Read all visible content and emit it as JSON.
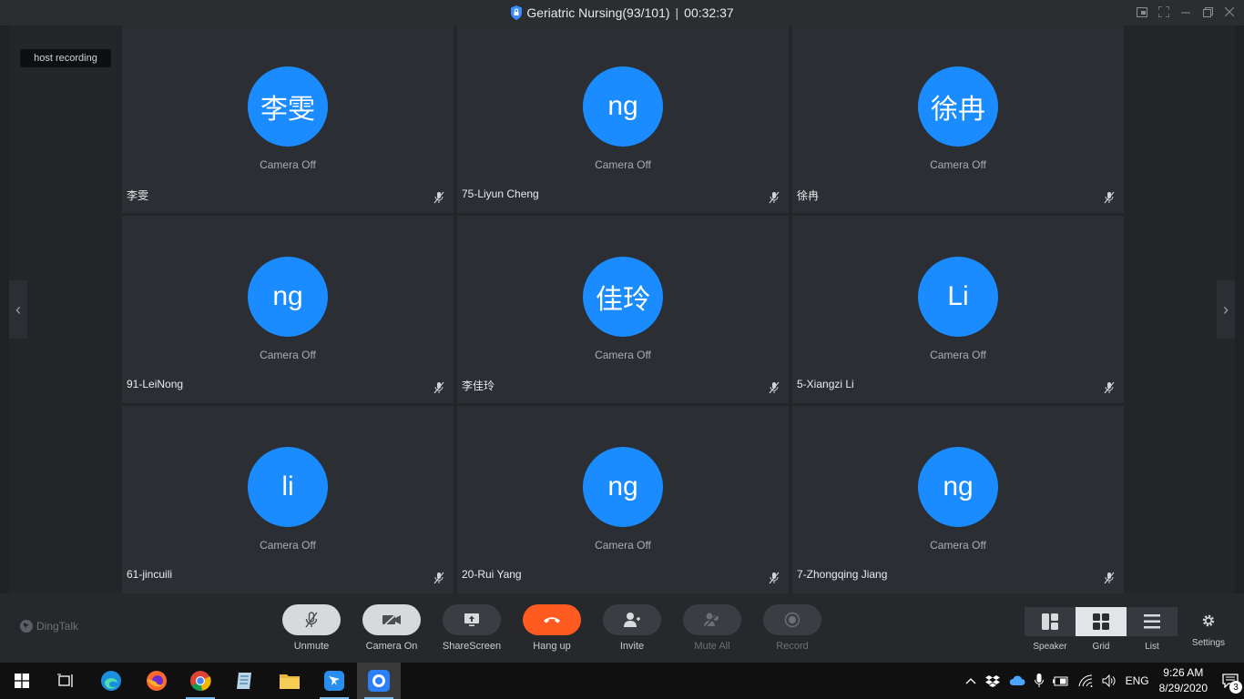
{
  "window": {
    "title": "Geriatric Nursing(93/101)",
    "separator": "|",
    "timer": "00:32:37"
  },
  "stage": {
    "recording_badge": "host recording",
    "nav_prev": "‹",
    "nav_next": "›"
  },
  "participants": [
    {
      "avatar_text": "李雯",
      "camera_status": "Camera Off",
      "name": "李雯"
    },
    {
      "avatar_text": "ng",
      "camera_status": "Camera Off",
      "name": "75-Liyun Cheng"
    },
    {
      "avatar_text": "徐冉",
      "camera_status": "Camera Off",
      "name": "徐冉"
    },
    {
      "avatar_text": "ng",
      "camera_status": "Camera Off",
      "name": "91-LeiNong"
    },
    {
      "avatar_text": "佳玲",
      "camera_status": "Camera Off",
      "name": "李佳玲"
    },
    {
      "avatar_text": "Li",
      "camera_status": "Camera Off",
      "name": "5-Xiangzi Li"
    },
    {
      "avatar_text": "li",
      "camera_status": "Camera Off",
      "name": "61-jincuili"
    },
    {
      "avatar_text": "ng",
      "camera_status": "Camera Off",
      "name": "20-Rui Yang"
    },
    {
      "avatar_text": "ng",
      "camera_status": "Camera Off",
      "name": "7-Zhongqing Jiang"
    }
  ],
  "toolbar": {
    "brand": "DingTalk",
    "unmute": "Unmute",
    "camera_on": "Camera On",
    "share_screen": "ShareScreen",
    "hang_up": "Hang up",
    "invite": "Invite",
    "mute_all": "Mute All",
    "record": "Record",
    "speaker": "Speaker",
    "grid": "Grid",
    "list": "List",
    "settings": "Settings"
  },
  "taskbar": {
    "language": "ENG",
    "time": "9:26 AM",
    "date": "8/29/2020",
    "notification_count": "3"
  },
  "colors": {
    "avatar_blue": "#1a8cff",
    "hangup_red": "#ff5a1f",
    "background": "#1f2124"
  }
}
